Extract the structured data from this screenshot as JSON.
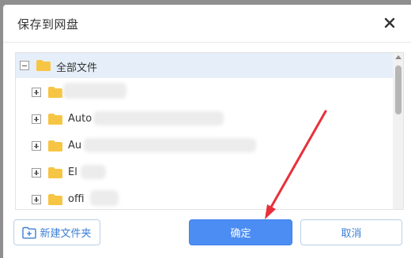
{
  "dialog": {
    "title": "保存到网盘",
    "close_icon": "close-icon"
  },
  "tree": {
    "root_label": "全部文件",
    "items": [
      {
        "label": ""
      },
      {
        "label": "Auto"
      },
      {
        "label": "Au"
      },
      {
        "label": "El"
      },
      {
        "label": "offi"
      }
    ]
  },
  "footer": {
    "new_folder_label": "新建文件夹",
    "confirm_label": "确定",
    "cancel_label": "取消"
  },
  "colors": {
    "accent": "#4c8df3",
    "arrow": "#e8303a",
    "folder": "#f7c544"
  }
}
